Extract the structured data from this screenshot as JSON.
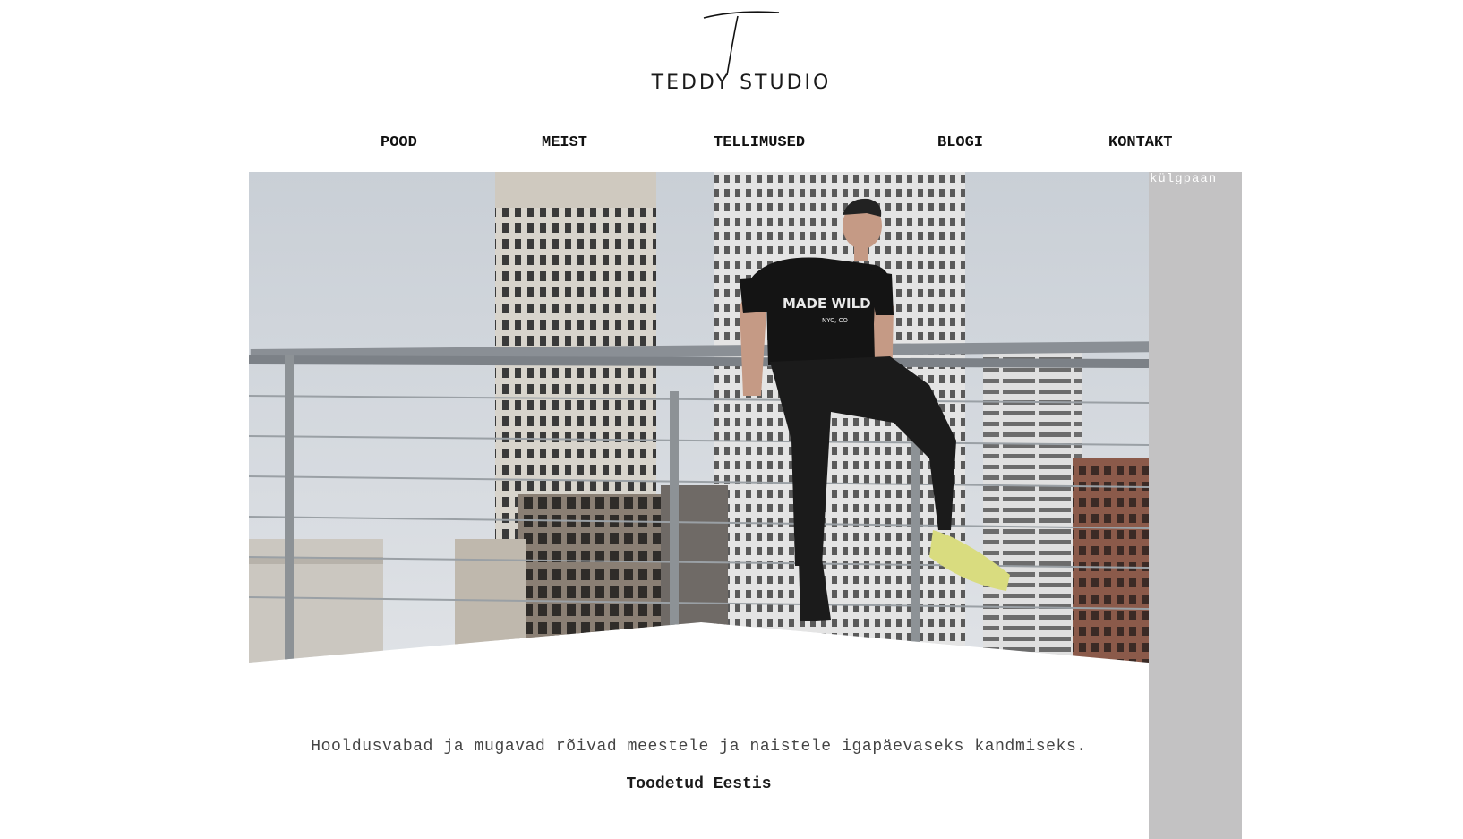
{
  "brand": {
    "logo_letter": "T",
    "name": "TEDDY STUDIO"
  },
  "nav": {
    "items": [
      {
        "label": "POOD"
      },
      {
        "label": "MEIST"
      },
      {
        "label": "TELLIMUSED"
      },
      {
        "label": "BLOGI"
      },
      {
        "label": "KONTAKT"
      }
    ]
  },
  "hero": {
    "image": "man-on-rooftop-railing-photo",
    "shirt_print": "MADE WILD",
    "shirt_sub": "NYC, CO"
  },
  "sidebar": {
    "label": "külgpaan",
    "color": "#c3c2c3"
  },
  "content": {
    "tagline": "Hooldusvabad ja mugavad rõivad meestele ja naistele igapäevaseks kandmiseks.",
    "made_in": "Toodetud Eestis"
  }
}
